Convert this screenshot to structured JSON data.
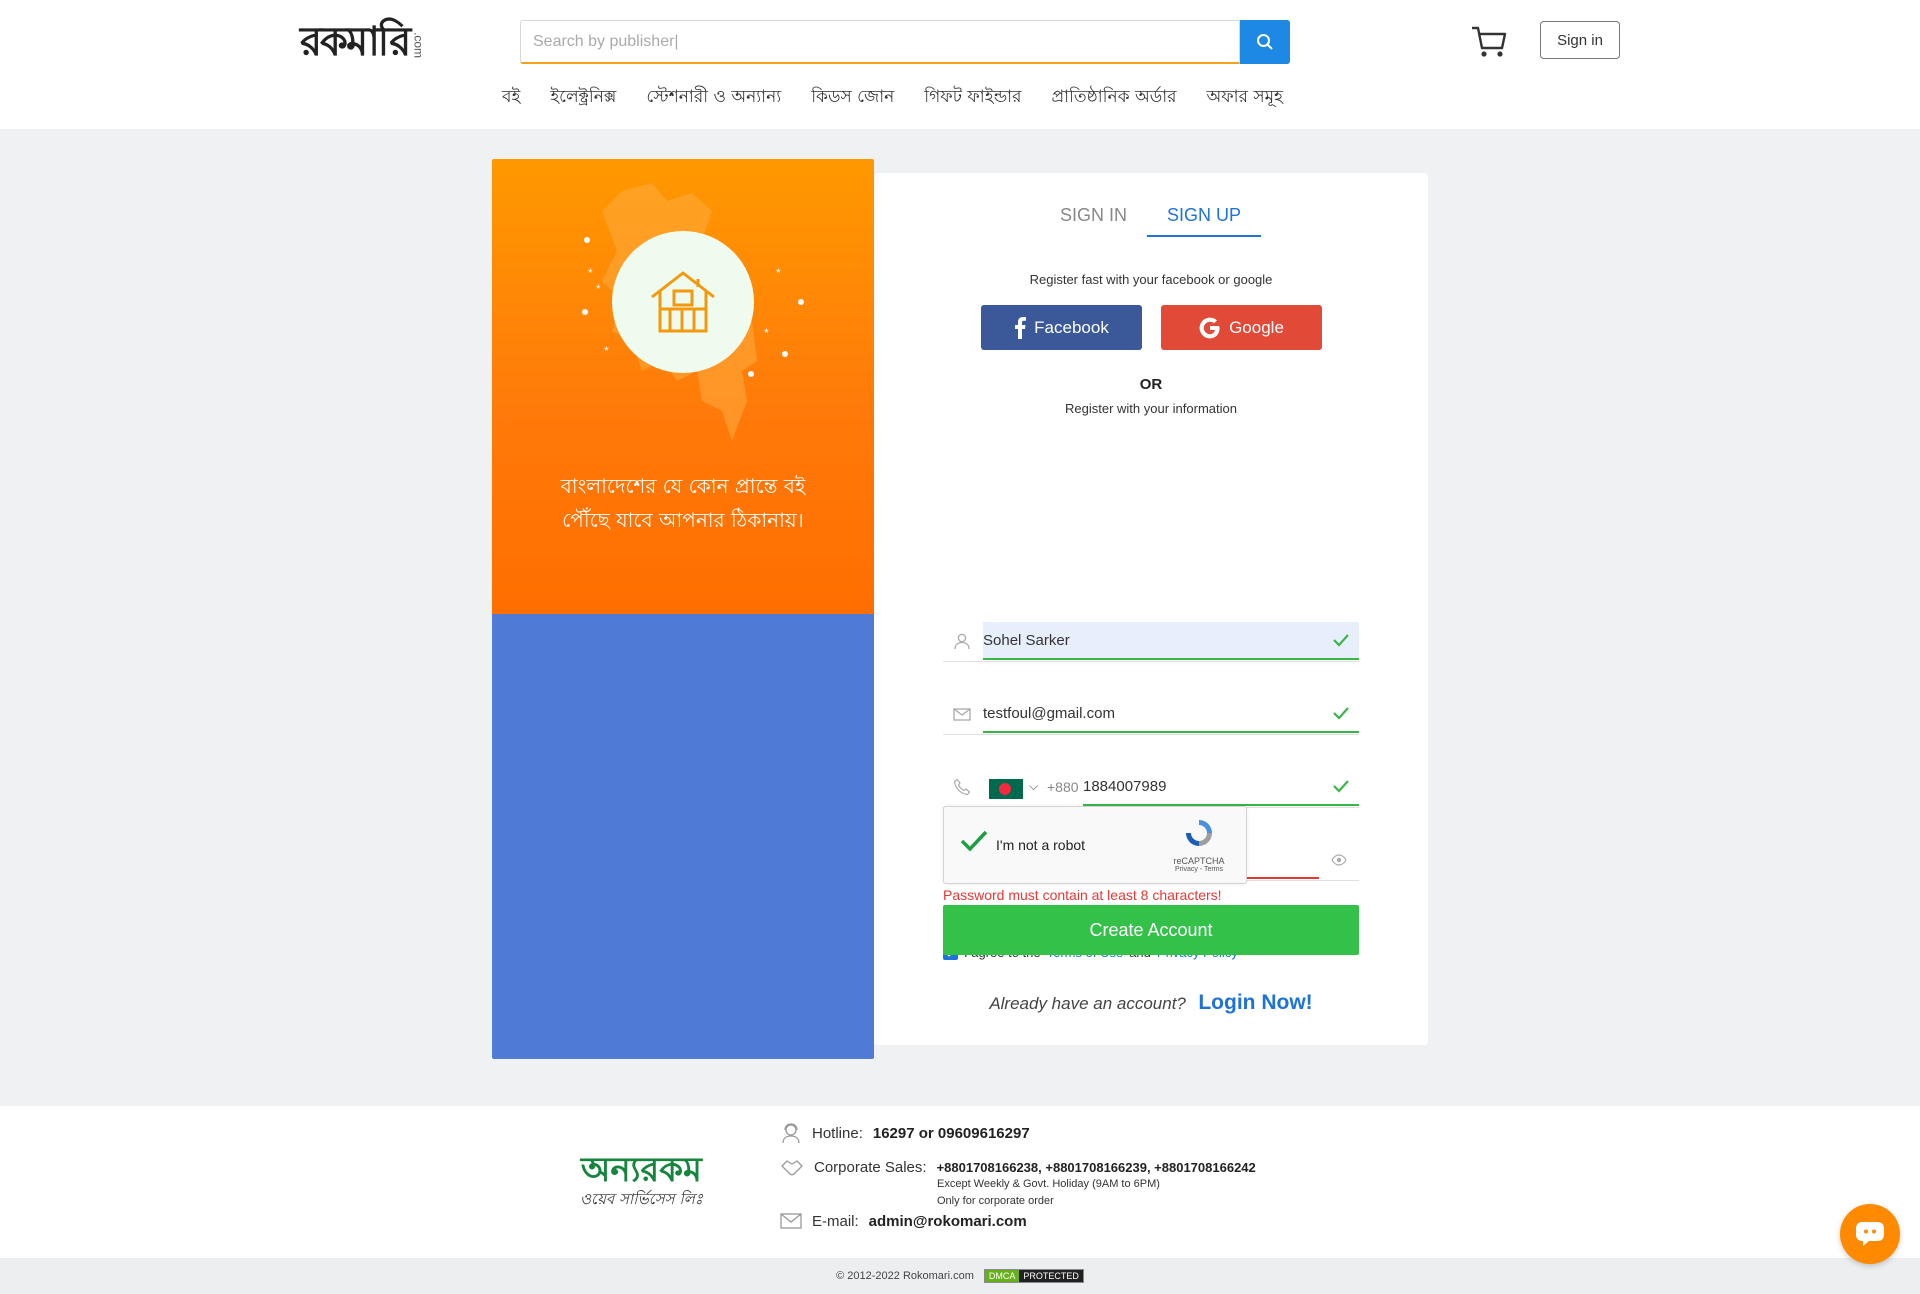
{
  "header": {
    "logo_text": "রকমারি",
    "logo_suffix": ".com",
    "search_placeholder": "Search by publisher|",
    "signin_label": "Sign in",
    "nav": [
      "বই",
      "ইলেক্ট্রনিক্স",
      "স্টেশনারী ও অন্যান্য",
      "কিডস জোন",
      "গিফট ফাইন্ডার",
      "প্রাতিষ্ঠানিক অর্ডার",
      "অফার সমূহ"
    ]
  },
  "promo": {
    "tagline_line1": "বাংলাদেশের যে কোন প্রান্তে বই",
    "tagline_line2": "পৌঁছে যাবে আপনার ঠিকানায়।",
    "orange_color": "#ff8800",
    "blue_color": "#4f7ad6"
  },
  "auth": {
    "tabs": [
      "SIGN IN",
      "SIGN UP"
    ],
    "active_tab": "SIGN UP",
    "register_fast": "Register fast with your facebook or google",
    "facebook_label": "Facebook",
    "google_label": "Google",
    "or_label": "OR",
    "register_info": "Register with your information",
    "name_value": "Sohel Sarker",
    "email_value": "testfoul@gmail.com",
    "dial_code": "+880",
    "phone_value": "1884007989",
    "password_value": "••••",
    "password_error": "Password must contain at least 8 characters!",
    "agree_prefix": "I agree to the",
    "terms_label": "Terms of Use",
    "agree_and": "and",
    "privacy_label": "Privacy Policy",
    "recaptcha_label": "I'm not a robot",
    "recaptcha_brand": "reCAPTCHA",
    "recaptcha_links": "Privacy - Terms",
    "create_label": "Create Account",
    "already_label": "Already have an account?",
    "login_now_label": "Login Now!"
  },
  "footer": {
    "logo_line1": "অন্যরকম",
    "logo_line2": "ওয়েব সার্ভিসেস লিঃ",
    "hotline_label": "Hotline:",
    "hotline_value": "16297  or  09609616297",
    "corporate_label": "Corporate Sales:",
    "corporate_value": "+8801708166238, +8801708166239, +8801708166242",
    "corporate_note1": "Except Weekly & Govt. Holiday (9AM to 6PM)",
    "corporate_note2": "Only for corporate order",
    "email_label": "E-mail:",
    "email_value": "admin@rokomari.com",
    "copyright": "© 2012-2022 Rokomari.com",
    "dmca_left": "DMCA",
    "dmca_right": "PROTECTED"
  }
}
